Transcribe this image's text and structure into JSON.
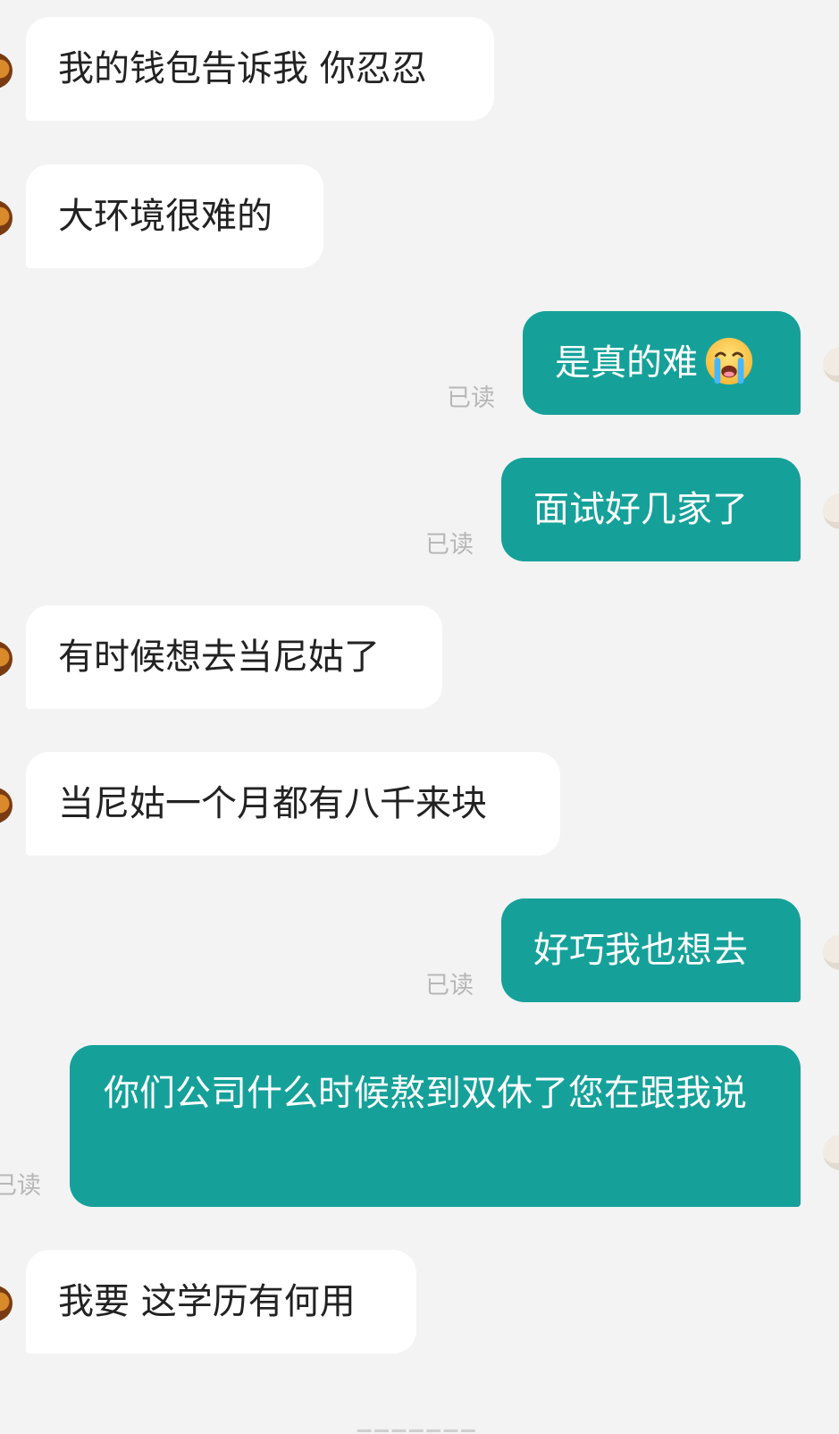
{
  "messages": [
    {
      "side": "in",
      "text": "我的钱包告诉我 你忍忍"
    },
    {
      "side": "in",
      "text": "大环境很难的"
    },
    {
      "side": "out",
      "text": "是真的难",
      "emoji": "crying-face-icon",
      "read": "已读"
    },
    {
      "side": "out",
      "text": "面试好几家了",
      "read": "已读"
    },
    {
      "side": "in",
      "text": "有时候想去当尼姑了"
    },
    {
      "side": "in",
      "text": "当尼姑一个月都有八千来块"
    },
    {
      "side": "out",
      "text": "好巧我也想去",
      "read": "已读"
    },
    {
      "side": "out",
      "text": "你们公司什么时候熬到双休了您在跟我说",
      "read": "已读"
    },
    {
      "side": "in",
      "text": "我要 这学历有何用"
    }
  ],
  "colors": {
    "background": "#f3f3f3",
    "incoming_bubble": "#ffffff",
    "outgoing_bubble": "#15a19a",
    "read_receipt": "#b7b7b7"
  }
}
